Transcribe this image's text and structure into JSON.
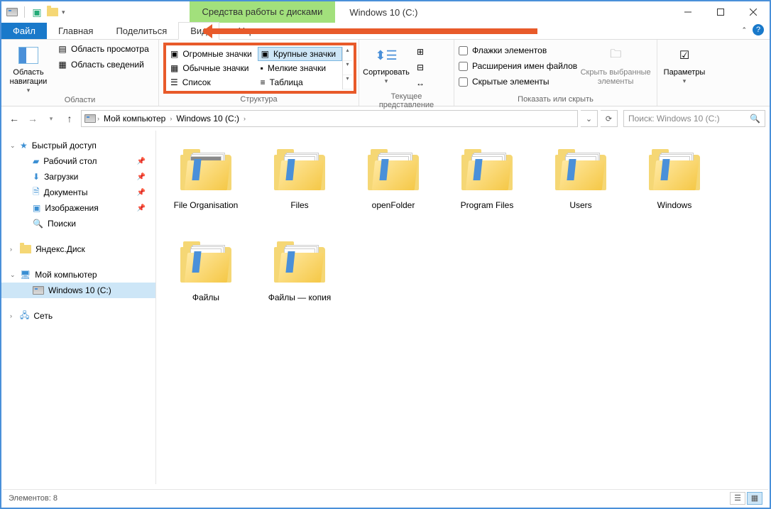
{
  "title": "Windows 10 (C:)",
  "context_tab": "Средства работы с дисками",
  "tabs": {
    "file": "Файл",
    "home": "Главная",
    "share": "Поделиться",
    "view": "Вид",
    "manage": "Управление"
  },
  "ribbon": {
    "panes": {
      "navigation": "Область навигации",
      "preview": "Область просмотра",
      "details": "Область сведений",
      "group_label": "Области"
    },
    "layout": {
      "extra_large": "Огромные значки",
      "large": "Крупные значки",
      "medium": "Обычные значки",
      "small": "Мелкие значки",
      "list": "Список",
      "table": "Таблица",
      "group_label": "Структура"
    },
    "current_view": {
      "sort": "Сортировать",
      "group_label": "Текущее представление"
    },
    "show_hide": {
      "checkboxes": "Флажки элементов",
      "extensions": "Расширения имен файлов",
      "hidden": "Скрытые элементы",
      "hide_selected": "Скрыть выбранные элементы",
      "group_label": "Показать или скрыть"
    },
    "options": "Параметры"
  },
  "breadcrumb": {
    "root": "Мой компьютер",
    "current": "Windows 10 (C:)"
  },
  "search_placeholder": "Поиск: Windows 10 (C:)",
  "sidebar": {
    "quick_access": "Быстрый доступ",
    "desktop": "Рабочий стол",
    "downloads": "Загрузки",
    "documents": "Документы",
    "pictures": "Изображения",
    "searches": "Поиски",
    "yandex_disk": "Яндекс.Диск",
    "this_pc": "Мой компьютер",
    "drive_c": "Windows 10 (C:)",
    "network": "Сеть"
  },
  "folders": [
    {
      "name": "File Organisation",
      "photo": true
    },
    {
      "name": "Files",
      "photo": false
    },
    {
      "name": "openFolder",
      "photo": false
    },
    {
      "name": "Program Files",
      "photo": false
    },
    {
      "name": "Users",
      "photo": false
    },
    {
      "name": "Windows",
      "photo": false
    },
    {
      "name": "Файлы",
      "photo": false
    },
    {
      "name": "Файлы — копия",
      "photo": false
    }
  ],
  "status": "Элементов: 8"
}
